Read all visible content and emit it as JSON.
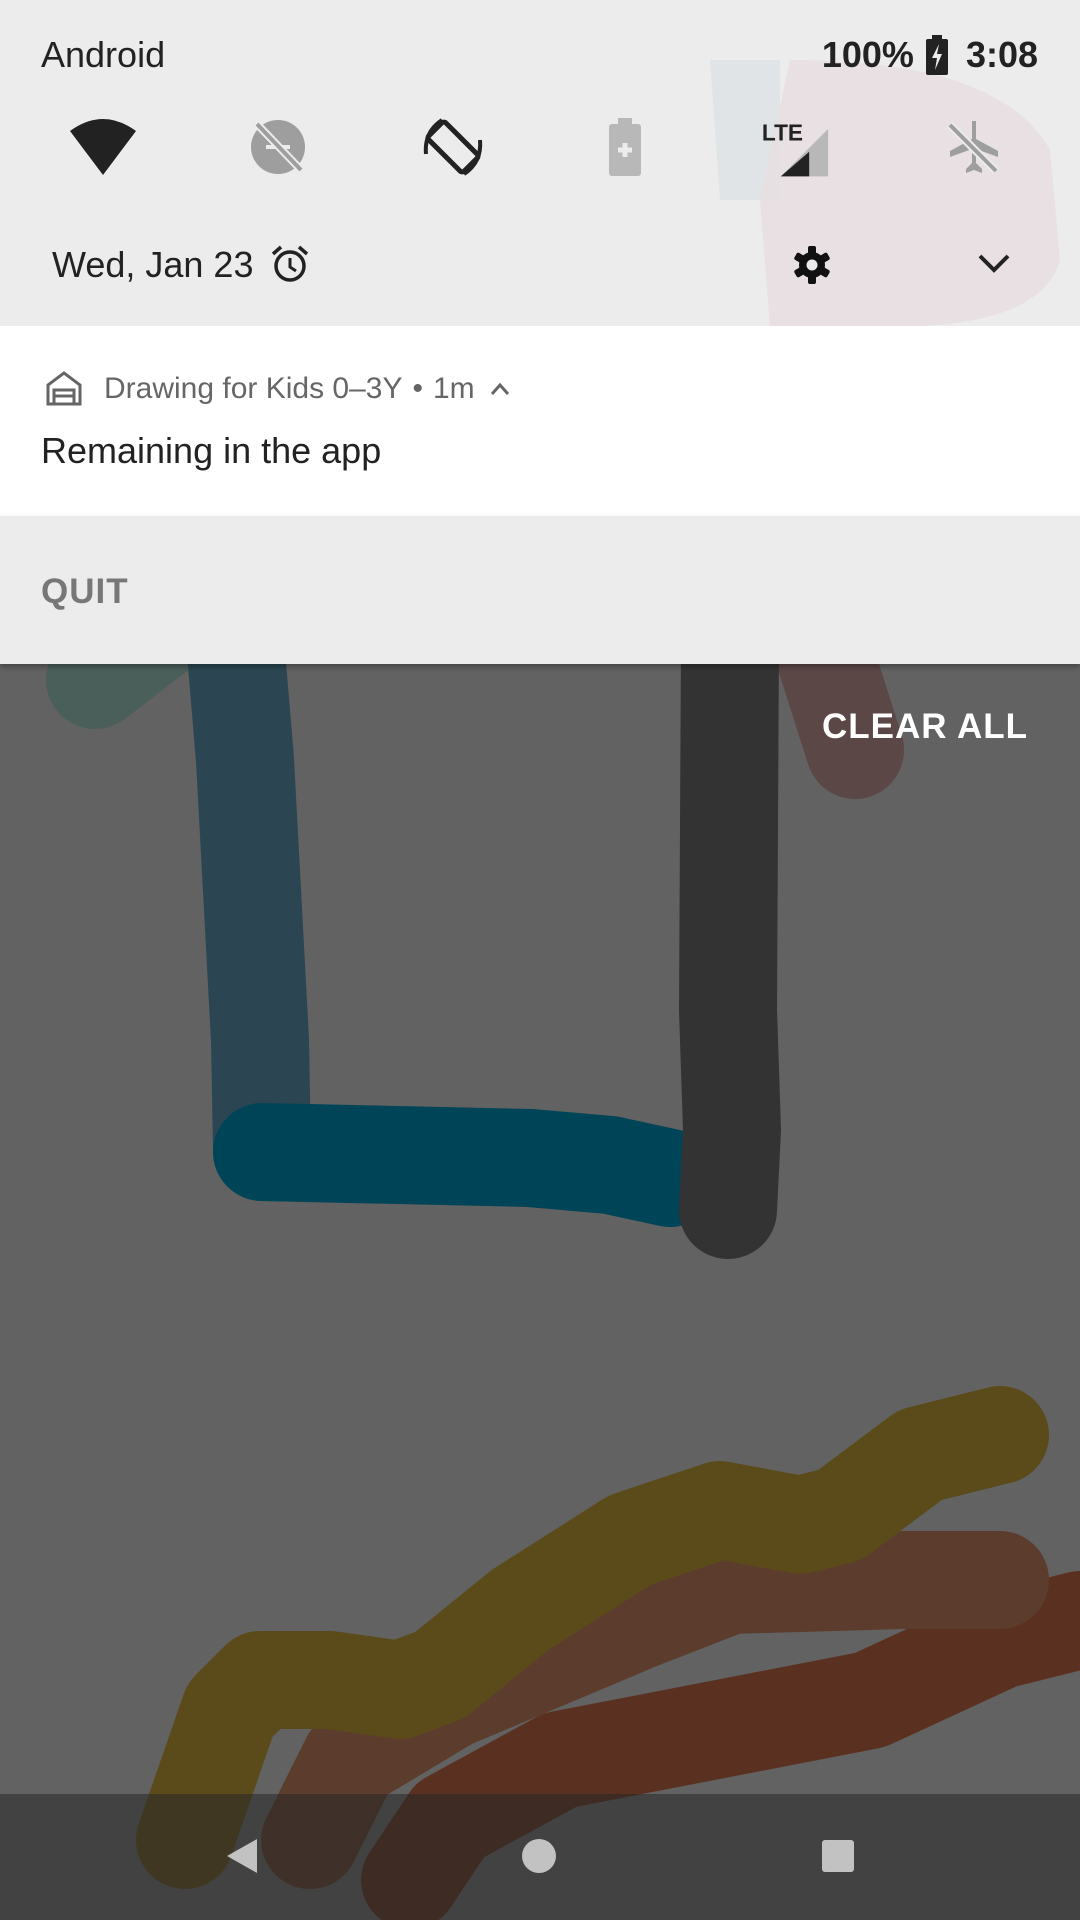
{
  "status_bar": {
    "carrier": "Android",
    "battery": "100%",
    "time": "3:08"
  },
  "quick_settings": {
    "tiles": [
      {
        "name": "wifi-icon",
        "state": "on"
      },
      {
        "name": "data-saver-off-icon",
        "state": "off"
      },
      {
        "name": "auto-rotate-icon",
        "state": "on"
      },
      {
        "name": "battery-saver-icon",
        "state": "off"
      },
      {
        "name": "lte-signal-icon",
        "label": "LTE",
        "state": "on"
      },
      {
        "name": "airplane-mode-off-icon",
        "state": "off"
      }
    ],
    "date": "Wed, Jan 23"
  },
  "notification": {
    "app_name": "Drawing for Kids 0–3Y",
    "separator": "•",
    "age": "1m",
    "title": "Remaining in the app",
    "action": "QUIT"
  },
  "clear_all": "CLEAR ALL",
  "nav": [
    "back-icon",
    "home-icon",
    "recents-icon"
  ]
}
